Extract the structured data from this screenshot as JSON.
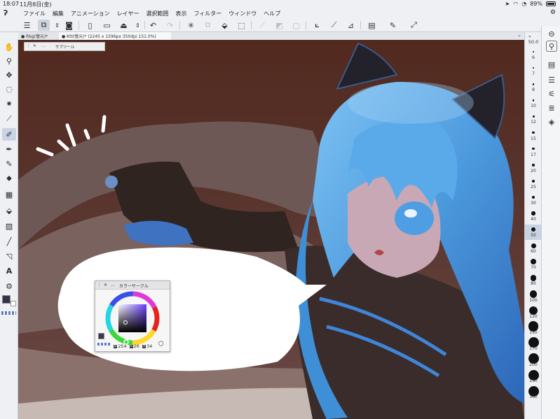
{
  "status_bar": {
    "time": "18:07",
    "date": "11月8日(金)",
    "battery": "89%"
  },
  "menu": {
    "items": [
      "ファイル",
      "編集",
      "アニメーション",
      "レイヤー",
      "選択範囲",
      "表示",
      "フィルター",
      "ウィンドウ",
      "ヘルプ"
    ]
  },
  "tabs": [
    {
      "label": "Rkg(復元)*"
    },
    {
      "label": "Ktt(復元)* (2245 x 1596px 350dpi 151.0%)"
    }
  ],
  "subtool_panel": {
    "title": "サブツール"
  },
  "color_panel": {
    "title": "カラーサークル",
    "h_label": "H",
    "h_value": "254",
    "s_label": "S",
    "s_value": "26",
    "v_label": "V",
    "v_value": "34",
    "current_color": "#3a3450",
    "hue_color": "#6a40ff"
  },
  "brush_sizes": {
    "current": "50.0",
    "labels": [
      "6",
      "7",
      "8",
      "10",
      "12",
      "15",
      "17",
      "20",
      "25",
      "30",
      "40",
      "50",
      "60",
      "70",
      "80",
      "100",
      "120",
      "150",
      "170",
      "200",
      "250",
      "300"
    ],
    "selected": "50"
  },
  "colors": {
    "accent": "#3f7ad9",
    "canvas_bg": "#4a2a20",
    "hair": "#3f8fd6",
    "foreground_color": "#343446"
  }
}
